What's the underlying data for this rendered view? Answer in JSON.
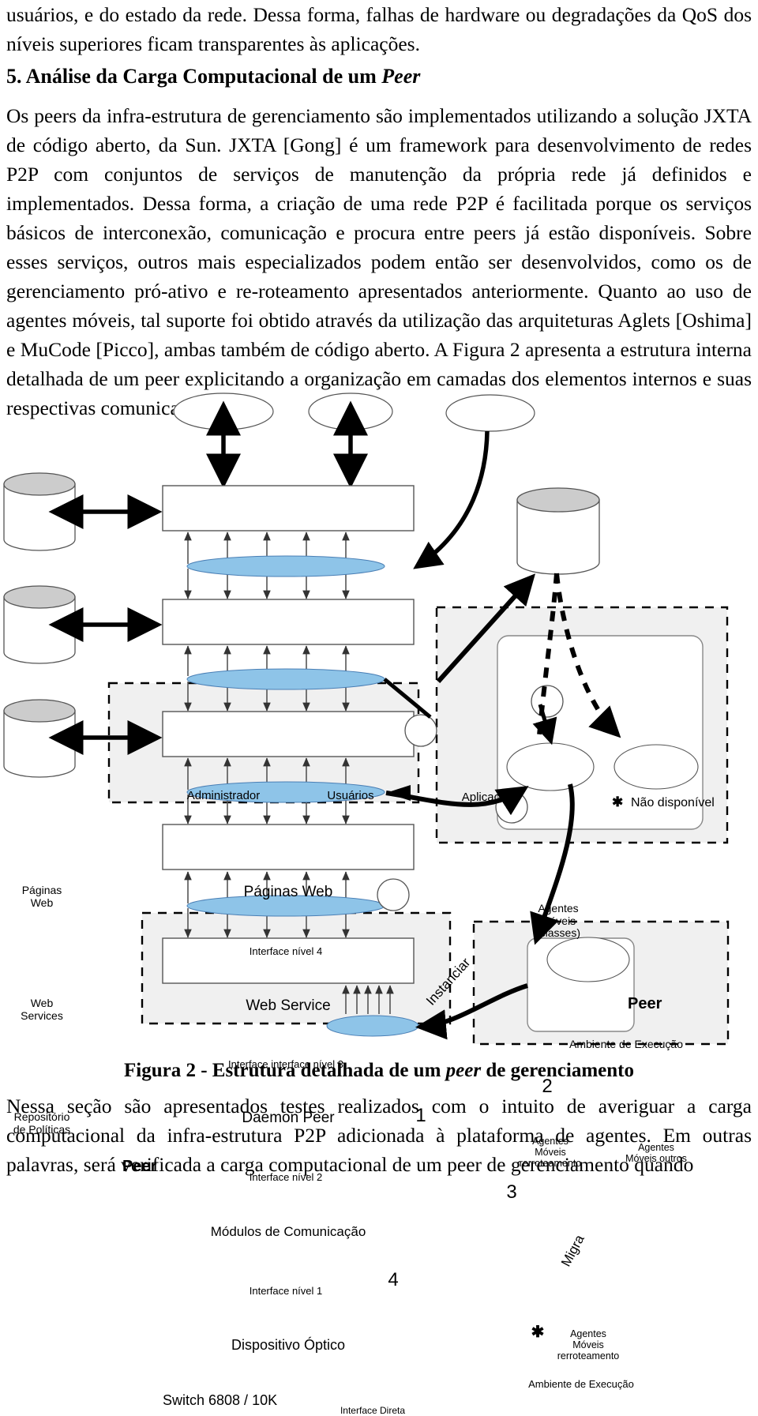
{
  "document": {
    "paragraph_top": "usuários, e do estado da rede. Dessa forma, falhas de hardware ou degradações da QoS dos níveis superiores ficam transparentes às aplicações.",
    "section_number": "5.",
    "section_title_plain_1": "Análise da Carga Computacional de um ",
    "section_title_italic": "Peer",
    "body_paragraph": "Os peers da infra-estrutura de gerenciamento são implementados utilizando a solução JXTA de código aberto, da Sun. JXTA [Gong] é um framework para desenvolvimento de redes P2P com conjuntos de serviços de manutenção da própria rede já definidos e implementados. Dessa forma, a criação de uma rede P2P é facilitada porque os serviços básicos de interconexão, comunicação e procura entre peers já estão disponíveis. Sobre esses serviços, outros mais especializados podem então ser desenvolvidos, como os de gerenciamento pró-ativo e re-roteamento apresentados anteriormente. Quanto ao uso de agentes móveis, tal suporte foi obtido através da utilização das arquiteturas Aglets [Oshima] e MuCode [Picco], ambas também de código aberto. A Figura 2 apresenta a estrutura interna detalhada de um peer explicitando a organização em camadas dos elementos internos e suas respectivas comunicações.",
    "figure_caption_prefix": "Figura 2 - Estrutura detalhada de um ",
    "figure_caption_italic": "peer",
    "figure_caption_suffix": " de gerenciamento",
    "bottom_paragraph": "Nessa seção são apresentados testes realizados com o intuito de averiguar a carga computacional da infra-estrutura P2P adicionada à plataforma de agentes. Em outras palavras, será verificada a carga computacional de um peer de gerenciamento quando"
  },
  "figure": {
    "actors": [
      {
        "label": "Administrador"
      },
      {
        "label": "Usuários"
      },
      {
        "label": "Aplicações"
      }
    ],
    "legend": {
      "symbol": "✱",
      "text": "Não disponível"
    },
    "datastores": [
      {
        "label": "Páginas\nWeb"
      },
      {
        "label": "Web\nServices"
      },
      {
        "label": "Repositório\nde Políticas"
      },
      {
        "label": "Agentes\nMóveis\n(classes)"
      }
    ],
    "layers": [
      {
        "label": "Páginas Web"
      },
      {
        "label": "Web Service"
      },
      {
        "label": "Daemon Peer"
      },
      {
        "label": "Módulos de Comunicação"
      },
      {
        "label": "Dispositivo Óptico"
      }
    ],
    "interfaces": [
      {
        "label": "Interface nível 4"
      },
      {
        "label": "Interface interface nível 3"
      },
      {
        "label": "Interface nível 2"
      },
      {
        "label": "Interface nível 1"
      },
      {
        "label": "Interface Direta"
      }
    ],
    "zone_labels": [
      {
        "label": "Peer"
      },
      {
        "label": "Peer"
      },
      {
        "label": "Switch 6808 / 10K"
      }
    ],
    "exec_envs": [
      {
        "label": "Ambiente de Execução"
      },
      {
        "label": "Ambiente de Execução"
      }
    ],
    "agent_ellipses": [
      {
        "label": "Agentes\nMóveis\nrerroteamento"
      },
      {
        "label": "Agentes\nMóveis  outros"
      },
      {
        "label": "Agentes\nMóveis\nrerroteamento"
      }
    ],
    "edge_labels": [
      {
        "label": "Instanciar"
      },
      {
        "label": "Migra"
      }
    ],
    "step_markers": [
      {
        "label": "1"
      },
      {
        "label": "2"
      },
      {
        "label": "3"
      },
      {
        "label": "4"
      }
    ],
    "asterisk_marker": "✱",
    "colors": {
      "interface_fill": "#8ec4e8",
      "interface_stroke": "#4a7fb5",
      "zone_fill": "#f0f0f0",
      "cylinder_top_fill": "#cccccc",
      "stroke": "#000000",
      "box_stroke": "#555555"
    }
  }
}
